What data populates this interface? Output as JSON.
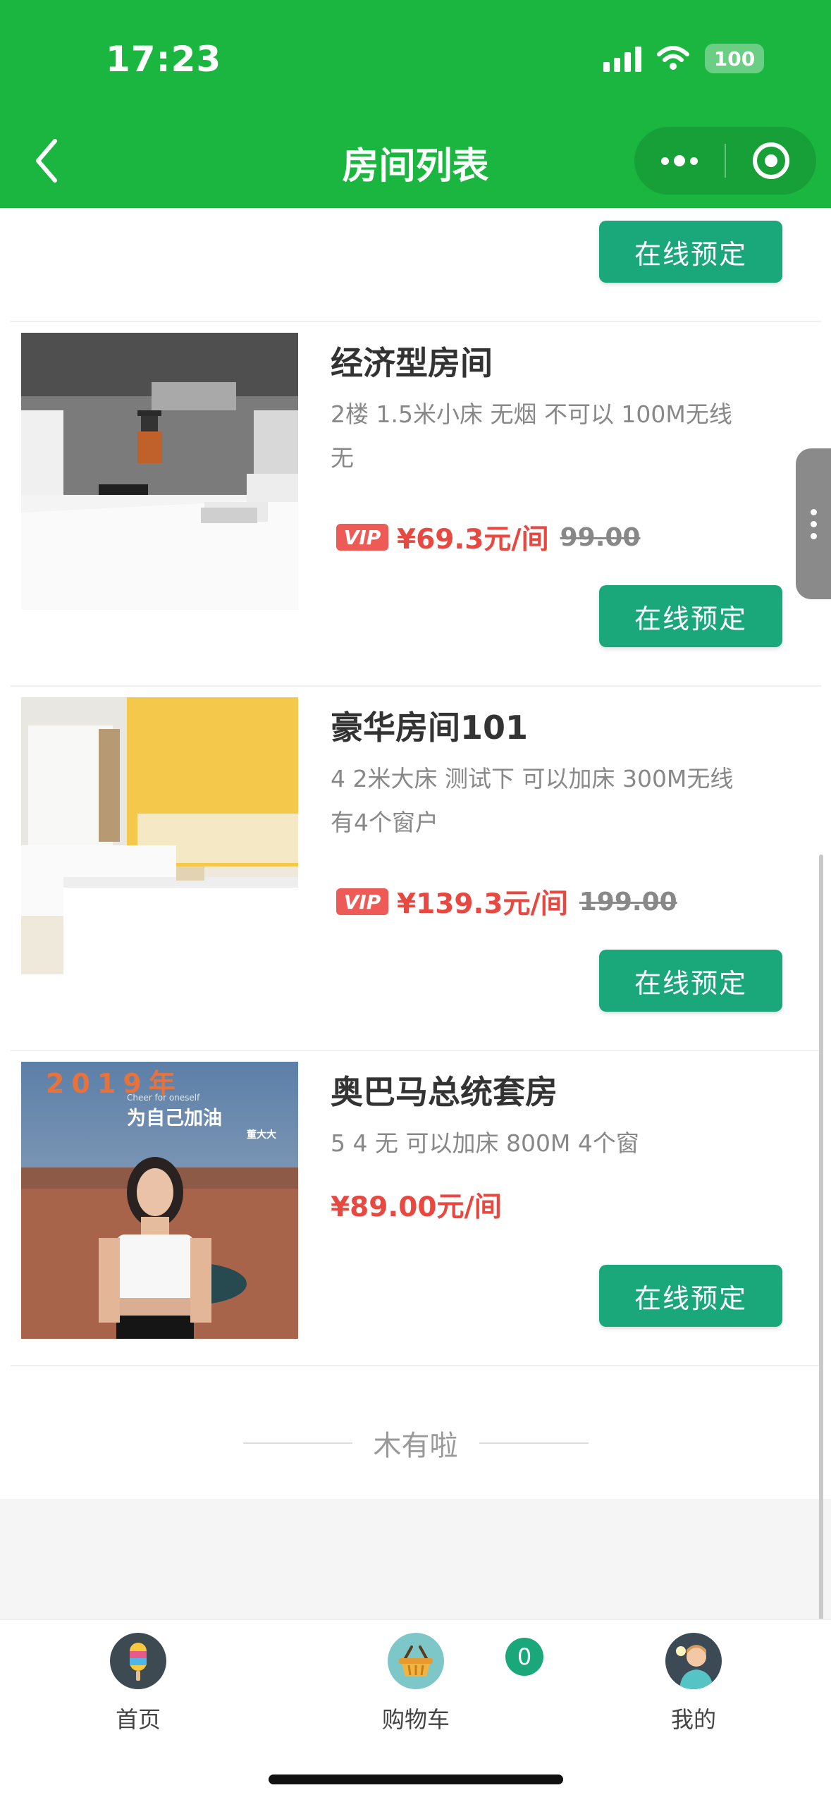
{
  "status_bar": {
    "time": "17:23",
    "battery": "100"
  },
  "nav": {
    "title": "房间列表"
  },
  "booking_button_label": "在线预定",
  "vip_label": "VIP",
  "rooms": [
    {
      "name": "经济型房间",
      "desc_line1": "2楼  1.5米小床  无烟  不可以  100M无线",
      "desc_line2": "无",
      "price": "¥69.3元/间",
      "original_price": "99.00"
    },
    {
      "name": "豪华房间101",
      "desc_line1": "4  2米大床  测试下  可以加床  300M无线",
      "desc_line2": "有4个窗户",
      "price": "¥139.3元/间",
      "original_price": "199.00"
    },
    {
      "name": "奥巴马总统套房",
      "desc_line1": "5  4  无  可以加床  800M  4个窗",
      "price": "¥89.00元/间",
      "poster": {
        "year": "2019年",
        "line1": "为自己加油",
        "line2": "Cheer for oneself",
        "tag": "董大大"
      }
    }
  ],
  "end_text": "木有啦",
  "tabbar": {
    "items": [
      {
        "label": "首页",
        "icon": "popsicle-icon"
      },
      {
        "label": "购物车",
        "icon": "basket-icon"
      },
      {
        "label": "我的",
        "icon": "user-avatar-icon"
      }
    ],
    "cart_count": "0"
  },
  "colors": {
    "header": "#1bb640",
    "button": "#1aa77a",
    "price": "#e8483f",
    "vip": "#ee5a55"
  }
}
